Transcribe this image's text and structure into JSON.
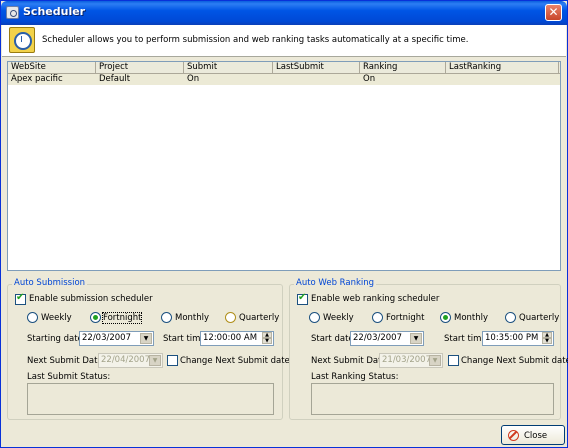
{
  "window": {
    "title": "Scheduler"
  },
  "header": {
    "text": "Scheduler allows you to perform submission and web ranking tasks automatically at a specific time."
  },
  "grid": {
    "columns": [
      "WebSite",
      "Project",
      "Submit",
      "LastSubmit",
      "Ranking",
      "LastRanking"
    ],
    "rows": [
      {
        "website": "Apex pacific",
        "project": "Default",
        "submit": "On",
        "lastsubmit": "",
        "ranking": "On",
        "lastranking": ""
      }
    ]
  },
  "auto_submission": {
    "title": "Auto Submission",
    "enable_label": "Enable submission scheduler",
    "enable_checked": true,
    "frequency": {
      "weekly": "Weekly",
      "fortnight": "Fortnight",
      "monthly": "Monthly",
      "quarterly": "Quarterly",
      "selected": "fortnight"
    },
    "starting_date_label": "Starting date:",
    "starting_date": "22/03/2007",
    "start_time_label": "Start time:",
    "start_time": "12:00:00 AM",
    "next_date_label": "Next Submit Date:",
    "next_date": "22/04/2007",
    "change_next_label": "Change Next Submit date",
    "status_label": "Last Submit Status:"
  },
  "auto_ranking": {
    "title": "Auto Web Ranking",
    "enable_label": "Enable web ranking scheduler",
    "enable_checked": true,
    "frequency": {
      "weekly": "Weekly",
      "fortnight": "Fortnight",
      "monthly": "Monthly",
      "quarterly": "Quarterly",
      "selected": "monthly"
    },
    "start_date_label": "Start date:",
    "start_date": "22/03/2007",
    "start_time_label": "Start time:",
    "start_time": "10:35:00 PM",
    "next_date_label": "Next Submit Date:",
    "next_date": "21/03/2007",
    "change_next_label": "Change Next Submit date",
    "status_label": "Last Ranking Status:"
  },
  "footer": {
    "close_label": "Close"
  },
  "colors": {
    "titlebar": "#0055e5",
    "group_title": "#0046d5",
    "check": "#21a121"
  }
}
